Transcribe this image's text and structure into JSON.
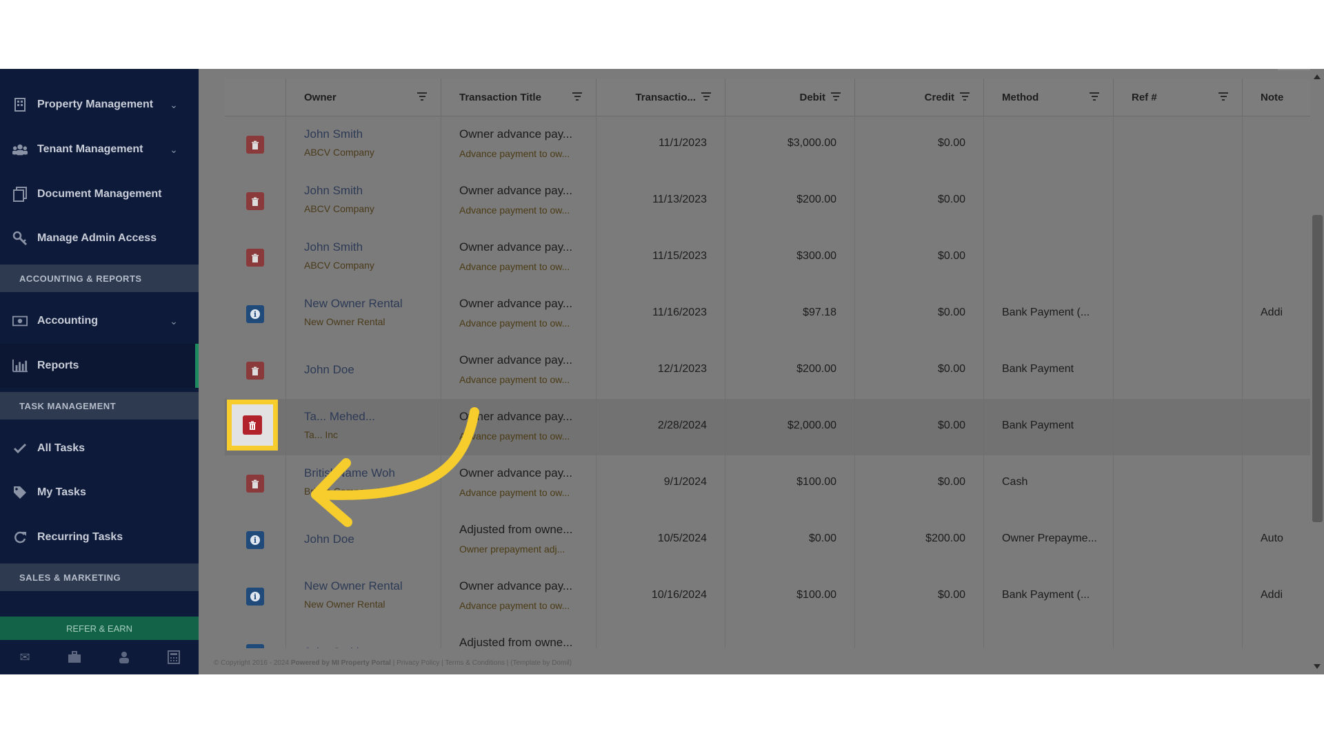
{
  "sidebar": {
    "items": [
      {
        "label": "Property Management",
        "icon": "building-icon",
        "chevron": true
      },
      {
        "label": "Tenant Management",
        "icon": "users-icon",
        "chevron": true
      },
      {
        "label": "Document Management",
        "icon": "documents-icon",
        "chevron": false
      },
      {
        "label": "Manage Admin Access",
        "icon": "key-icon",
        "chevron": false
      }
    ],
    "section_accounting": "ACCOUNTING & REPORTS",
    "accounting_label": "Accounting",
    "reports_label": "Reports",
    "section_tasks": "TASK MANAGEMENT",
    "all_tasks_label": "All Tasks",
    "my_tasks_label": "My Tasks",
    "recurring_tasks_label": "Recurring Tasks",
    "section_sales": "SALES & MARKETING",
    "refer_label": "REFER & EARN",
    "bottom_icons": [
      "envelope-icon",
      "briefcase-icon",
      "user-icon",
      "calculator-icon"
    ]
  },
  "table": {
    "headers": {
      "owner": "Owner",
      "title": "Transaction Title",
      "date": "Transactio...",
      "debit": "Debit",
      "credit": "Credit",
      "method": "Method",
      "ref": "Ref #",
      "note": "Note"
    },
    "rows": [
      {
        "action": "delete",
        "owner": "John Smith",
        "company": "ABCV Company",
        "title": "Owner advance pay...",
        "subtitle": "Advance payment to ow...",
        "date": "11/1/2023",
        "debit": "$3,000.00",
        "credit": "$0.00",
        "method": "",
        "note": ""
      },
      {
        "action": "delete",
        "owner": "John Smith",
        "company": "ABCV Company",
        "title": "Owner advance pay...",
        "subtitle": "Advance payment to ow...",
        "date": "11/13/2023",
        "debit": "$200.00",
        "credit": "$0.00",
        "method": "",
        "note": ""
      },
      {
        "action": "delete",
        "owner": "John Smith",
        "company": "ABCV Company",
        "title": "Owner advance pay...",
        "subtitle": "Advance payment to ow...",
        "date": "11/15/2023",
        "debit": "$300.00",
        "credit": "$0.00",
        "method": "",
        "note": ""
      },
      {
        "action": "info",
        "owner": "New Owner Rental",
        "company": "New Owner Rental",
        "title": "Owner advance pay...",
        "subtitle": "Advance payment to ow...",
        "date": "11/16/2023",
        "debit": "$97.18",
        "credit": "$0.00",
        "method": "Bank Payment (...",
        "note": "Addi"
      },
      {
        "action": "delete",
        "owner": "John Doe",
        "company": "",
        "title": "Owner advance pay...",
        "subtitle": "Advance payment to ow...",
        "date": "12/1/2023",
        "debit": "$200.00",
        "credit": "$0.00",
        "method": "Bank Payment",
        "note": ""
      },
      {
        "action": "delete",
        "owner": "Ta... Mehed...",
        "company": "Ta... Inc",
        "title": "Owner advance pay...",
        "subtitle": "Advance payment to ow...",
        "date": "2/28/2024",
        "debit": "$2,000.00",
        "credit": "$0.00",
        "method": "Bank Payment",
        "note": ""
      },
      {
        "action": "delete",
        "owner": "BritishName Woh",
        "company": "British Company Ltd.",
        "title": "Owner advance pay...",
        "subtitle": "Advance payment to ow...",
        "date": "9/1/2024",
        "debit": "$100.00",
        "credit": "$0.00",
        "method": "Cash",
        "note": ""
      },
      {
        "action": "info",
        "owner": "John Doe",
        "company": "",
        "title": "Adjusted from owne...",
        "subtitle": "Owner prepayment adj...",
        "date": "10/5/2024",
        "debit": "$0.00",
        "credit": "$200.00",
        "method": "Owner Prepayme...",
        "note": "Auto"
      },
      {
        "action": "info",
        "owner": "New Owner Rental",
        "company": "New Owner Rental",
        "title": "Owner advance pay...",
        "subtitle": "Advance payment to ow...",
        "date": "10/16/2024",
        "debit": "$100.00",
        "credit": "$0.00",
        "method": "Bank Payment (...",
        "note": "Addi"
      },
      {
        "action": "info",
        "owner": "John Smith",
        "company": "",
        "title": "Adjusted from owne...",
        "subtitle": "",
        "date": "",
        "debit": "",
        "credit": "",
        "method": "",
        "note": ""
      }
    ]
  },
  "footer": {
    "copyright": "© Copyright 2016 - 2024",
    "powered": "Powered by MI Property Portal",
    "privacy": "Privacy Policy",
    "terms": "Terms & Conditions",
    "credit": "(Template by Domil)"
  },
  "colors": {
    "sidebar_bg": "#0d1a3a",
    "highlight": "#f6cd2c",
    "delete_red": "#b1222a",
    "info_blue": "#1f4a7a",
    "refer_green": "#136349"
  }
}
